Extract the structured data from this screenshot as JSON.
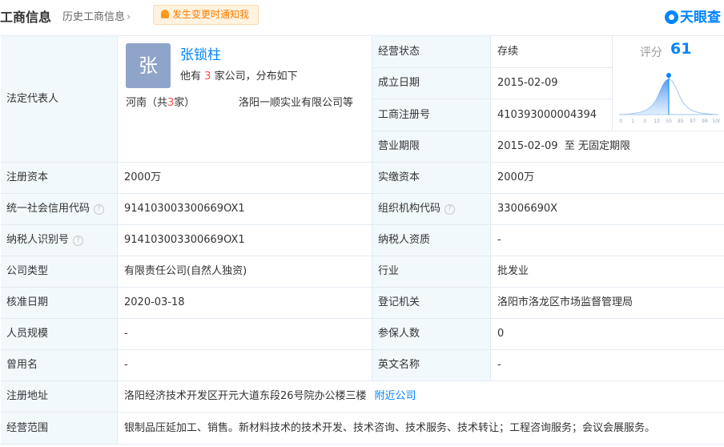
{
  "header": {
    "title": "工商信息",
    "history_link": "历史工商信息",
    "notify_button": "发生变更时通知我",
    "logo_text": "天眼查"
  },
  "legal_rep": {
    "label": "法定代表人",
    "avatar_char": "张",
    "name": "张锁柱",
    "companies_prefix": "他有",
    "companies_count": "3",
    "companies_suffix": "家公司，分布如下",
    "area_prefix": "河南（共",
    "area_count": "3",
    "area_suffix": "家）",
    "company": "洛阳一顺实业有限公司等"
  },
  "score": {
    "label": "评分",
    "value": "61",
    "ticks": [
      "0",
      "1",
      "3",
      "13",
      "50",
      "85",
      "97",
      "99",
      "100"
    ]
  },
  "right_top": [
    {
      "label": "经营状态",
      "value": "存续"
    },
    {
      "label": "成立日期",
      "value": "2015-02-09"
    },
    {
      "label": "工商注册号",
      "value": "410393000004394"
    },
    {
      "label": "营业期限",
      "value": "2015-02-09  至 无固定期限"
    }
  ],
  "rows": [
    {
      "l1": "注册资本",
      "v1": "2000万",
      "l2": "实缴资本",
      "v2": "2000万"
    },
    {
      "l1": "统一社会信用代码",
      "v1": "914103003300669OX1",
      "l2": "组织机构代码",
      "v2": "33006690X"
    },
    {
      "l1": "纳税人识别号",
      "v1": "914103003300669OX1",
      "l2": "纳税人资质",
      "v2": "-"
    },
    {
      "l1": "公司类型",
      "v1": "有限责任公司(自然人独资)",
      "l2": "行业",
      "v2": "批发业"
    },
    {
      "l1": "核准日期",
      "v1": "2020-03-18",
      "l2": "登记机关",
      "v2": "洛阳市洛龙区市场监督管理局"
    },
    {
      "l1": "人员规模",
      "v1": "-",
      "l2": "参保人数",
      "v2": "0"
    },
    {
      "l1": "曾用名",
      "v1": "-",
      "l2": "英文名称",
      "v2": "-"
    }
  ],
  "address": {
    "label": "注册地址",
    "value": "洛阳经济技术开发区开元大道东段26号院办公楼三楼",
    "link": "附近公司"
  },
  "scope": {
    "label": "经营范围",
    "value": "银制品压延加工、销售。新材料技术的技术开发、技术咨询、技术服务、技术转让；工程咨询服务；会议会展服务。"
  },
  "help_glyph": "?",
  "accent_color": "#0084ff",
  "label_bg_color": "#f2f9fc"
}
